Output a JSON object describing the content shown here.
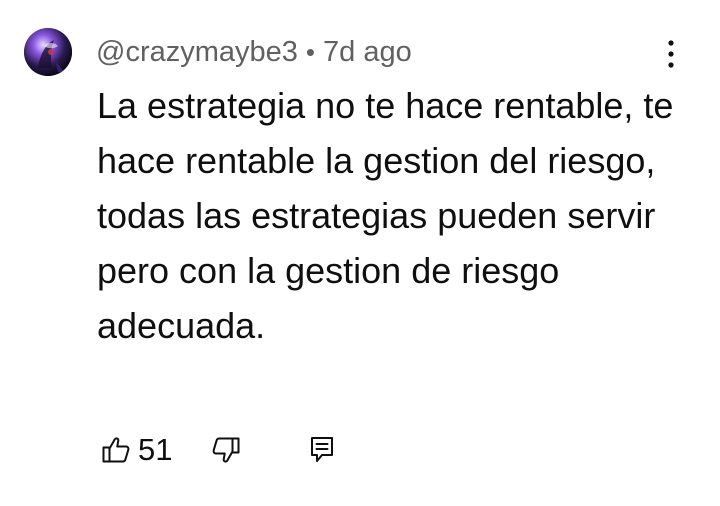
{
  "comment": {
    "author": "@crazymaybe3",
    "separator": "•",
    "time_ago": "7d ago",
    "text": "La estrategia no te hace rentable, te hace rentable la gestion del riesgo, todas las estrategias pueden servir pero con la gestion de riesgo adecuada.",
    "like_count": "51"
  },
  "icons": {
    "avatar": "user-avatar",
    "more": "more-vertical-icon",
    "like": "thumbs-up-icon",
    "dislike": "thumbs-down-icon",
    "reply": "reply-comment-icon"
  },
  "colors": {
    "text": "#0f0f0f",
    "meta": "#606060",
    "background": "#ffffff"
  }
}
